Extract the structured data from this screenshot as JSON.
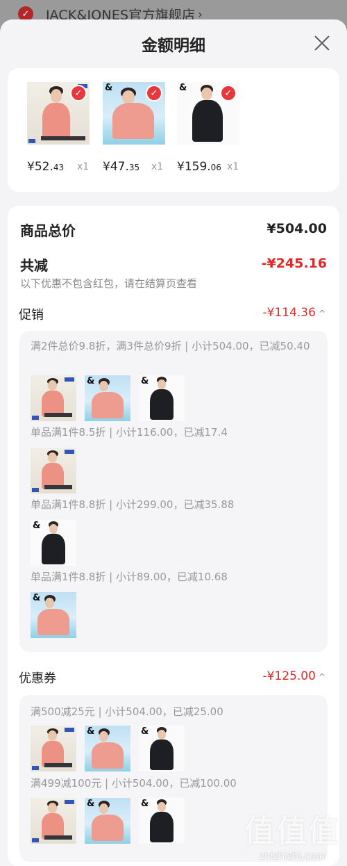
{
  "store": {
    "name": "JACK&JONES官方旗舰店",
    "arrow": "›",
    "check": "✓"
  },
  "sheet": {
    "title": "金额明细"
  },
  "products": [
    {
      "price_main": "¥52.",
      "price_cents": "43",
      "qty": "x1"
    },
    {
      "price_main": "¥47.",
      "price_cents": "35",
      "qty": "x1"
    },
    {
      "price_main": "¥159.",
      "price_cents": "06",
      "qty": "x1"
    }
  ],
  "summary": {
    "total_label": "商品总价",
    "total_value": "¥504.00",
    "discount_label": "共减",
    "discount_value": "-¥245.16",
    "note": "以下优惠不包含红包，请在结算页查看"
  },
  "promotion": {
    "label": "促销",
    "value": "-¥114.36",
    "rules": [
      "满2件总价9.8折，满3件总价9折 | 小计504.00，已减50.40",
      "单品满1件8.5折 | 小计116.00，已减17.4",
      "单品满1件8.8折 | 小计299.00，已减35.88",
      "单品满1件8.8折 | 小计89.00，已减10.68"
    ]
  },
  "coupon": {
    "label": "优惠券",
    "value": "-¥125.00",
    "rules": [
      "满500减25元 | 小计504.00，已减25.00",
      "满499减100元 | 小计504.00，已减100.00"
    ]
  },
  "caret": "^",
  "watermark": {
    "big": "值值值",
    "small": "zhizhizhi.com"
  },
  "colors": {
    "discount_red": "#e02a2a",
    "check_red": "#e8383d"
  }
}
